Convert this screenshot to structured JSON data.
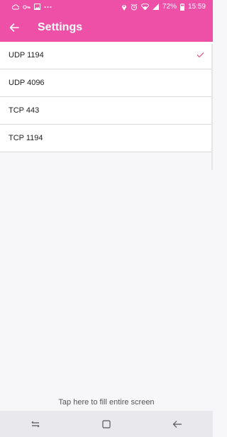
{
  "status_bar": {
    "battery_percent": "72%",
    "time": "15:59",
    "left_icons": [
      "cloud-icon",
      "key-icon",
      "image-icon",
      "more-dots-icon"
    ],
    "right_icons": [
      "location-icon",
      "alarm-icon",
      "wifi-icon",
      "signal-icon",
      "battery-icon"
    ]
  },
  "app_bar": {
    "title": "Settings",
    "background": "#ee4fa7"
  },
  "protocols": [
    {
      "label": "UDP 1194",
      "selected": true
    },
    {
      "label": "UDP 4096",
      "selected": false
    },
    {
      "label": "TCP 443",
      "selected": false
    },
    {
      "label": "TCP 1194",
      "selected": false
    }
  ],
  "check_color": "#e0608a",
  "fill_hint": "Tap here to fill entire screen",
  "nav_bar": {
    "buttons": [
      "recent-apps-icon",
      "home-icon",
      "back-icon"
    ]
  }
}
